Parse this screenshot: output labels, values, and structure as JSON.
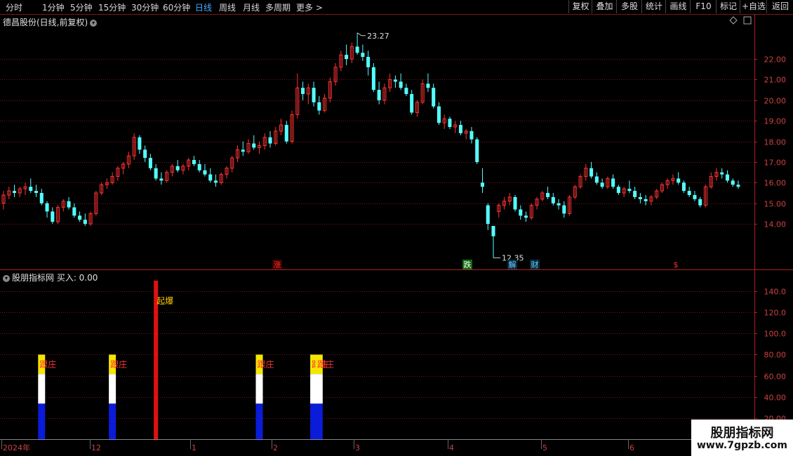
{
  "toolbar": {
    "periods": [
      "分时",
      "1分钟",
      "5分钟",
      "15分钟",
      "30分钟",
      "60分钟",
      "日线",
      "周线",
      "月线",
      "多周期",
      "更多 >"
    ],
    "active_period": "日线",
    "buttons": [
      "复权",
      "叠加",
      "多股",
      "统计",
      "画线",
      "F10",
      "标记",
      "+自选",
      "返回"
    ]
  },
  "stock": {
    "title": "德昌股份(日线,前复权)"
  },
  "indicator": {
    "title": "股朋指标网 买入: 0.00"
  },
  "price_labels": {
    "high": "23.27",
    "low": "12.35"
  },
  "markers": [
    {
      "text": "涨",
      "color": "#ff3030",
      "bg": "#3a0000"
    },
    {
      "text": "跌",
      "color": "#ffffff",
      "bg": "#0f6a0f"
    },
    {
      "text": "解",
      "color": "#66ccff",
      "bg": "#0a2a3a"
    },
    {
      "text": "财",
      "color": "#66ccff",
      "bg": "#0a2a3a"
    },
    {
      "text": "$",
      "color": "#ff3030",
      "bg": "#000000"
    }
  ],
  "signals": {
    "genzhuang": "跟庄",
    "qibao": "起爆"
  },
  "watermark": {
    "line1": "股朋指标网",
    "line2": "www.7gpzb.com"
  },
  "colors": {
    "up": "#ff3232",
    "down": "#54ffff",
    "grid": "#7a1414"
  },
  "chart_data": {
    "type": "candlestick",
    "price_axis": {
      "ticks": [
        "22.00",
        "21.00",
        "20.00",
        "19.00",
        "18.00",
        "17.00",
        "16.00",
        "15.00",
        "14.00"
      ],
      "range": [
        12.2,
        23.5
      ]
    },
    "indicator_axis": {
      "ticks": [
        "140.0",
        "120.0",
        "100.0",
        "80.00",
        "60.00",
        "40.00",
        "20.00"
      ],
      "range": [
        0,
        150
      ]
    },
    "date_labels": [
      "2024年",
      "12",
      "1",
      "2",
      "3",
      "4",
      "5",
      "6"
    ],
    "ohlc": [
      [
        15.0,
        15.6,
        14.7,
        15.4
      ],
      [
        15.4,
        15.8,
        15.2,
        15.6
      ],
      [
        15.6,
        15.9,
        15.3,
        15.5
      ],
      [
        15.5,
        15.8,
        15.3,
        15.7
      ],
      [
        15.7,
        16.0,
        15.4,
        15.8
      ],
      [
        15.8,
        16.2,
        15.5,
        15.6
      ],
      [
        15.6,
        15.9,
        15.3,
        15.5
      ],
      [
        15.5,
        15.7,
        14.9,
        15.0
      ],
      [
        15.0,
        15.1,
        14.3,
        14.6
      ],
      [
        14.6,
        14.8,
        14.0,
        14.1
      ],
      [
        14.1,
        14.9,
        14.0,
        14.8
      ],
      [
        14.8,
        15.2,
        14.6,
        15.1
      ],
      [
        15.1,
        15.3,
        14.7,
        14.8
      ],
      [
        14.8,
        15.0,
        14.3,
        14.4
      ],
      [
        14.4,
        14.6,
        14.1,
        14.2
      ],
      [
        14.2,
        14.5,
        13.9,
        14.0
      ],
      [
        14.0,
        14.6,
        13.9,
        14.5
      ],
      [
        14.5,
        15.6,
        14.4,
        15.5
      ],
      [
        15.5,
        16.0,
        15.4,
        15.9
      ],
      [
        15.9,
        16.2,
        15.7,
        16.0
      ],
      [
        16.0,
        16.5,
        15.9,
        16.3
      ],
      [
        16.3,
        16.8,
        16.1,
        16.7
      ],
      [
        16.7,
        17.0,
        16.4,
        16.9
      ],
      [
        16.9,
        17.5,
        16.7,
        17.3
      ],
      [
        17.3,
        18.4,
        17.1,
        18.2
      ],
      [
        18.2,
        18.3,
        17.4,
        17.6
      ],
      [
        17.6,
        17.8,
        17.0,
        17.2
      ],
      [
        17.2,
        17.4,
        16.6,
        16.7
      ],
      [
        16.7,
        16.9,
        16.1,
        16.2
      ],
      [
        16.2,
        16.5,
        15.9,
        16.1
      ],
      [
        16.1,
        16.6,
        16.0,
        16.5
      ],
      [
        16.5,
        16.9,
        16.3,
        16.8
      ],
      [
        16.8,
        17.1,
        16.5,
        16.6
      ],
      [
        16.6,
        16.9,
        16.4,
        16.8
      ],
      [
        16.8,
        17.2,
        16.6,
        17.1
      ],
      [
        17.1,
        17.3,
        16.8,
        16.9
      ],
      [
        16.9,
        17.1,
        16.5,
        16.6
      ],
      [
        16.6,
        16.9,
        16.3,
        16.4
      ],
      [
        16.4,
        16.7,
        16.0,
        16.1
      ],
      [
        16.1,
        16.4,
        15.8,
        16.0
      ],
      [
        16.0,
        16.5,
        15.9,
        16.4
      ],
      [
        16.4,
        16.8,
        16.2,
        16.7
      ],
      [
        16.7,
        17.3,
        16.5,
        17.2
      ],
      [
        17.2,
        17.8,
        17.0,
        17.6
      ],
      [
        17.6,
        18.0,
        17.3,
        17.5
      ],
      [
        17.5,
        18.1,
        17.4,
        17.9
      ],
      [
        17.9,
        18.3,
        17.6,
        17.7
      ],
      [
        17.7,
        18.0,
        17.4,
        17.8
      ],
      [
        17.8,
        18.4,
        17.6,
        18.2
      ],
      [
        18.2,
        18.5,
        17.7,
        17.9
      ],
      [
        17.9,
        18.7,
        17.8,
        18.5
      ],
      [
        18.5,
        19.1,
        18.3,
        18.8
      ],
      [
        18.8,
        19.0,
        17.9,
        18.0
      ],
      [
        18.0,
        19.5,
        17.9,
        19.3
      ],
      [
        19.3,
        21.3,
        19.1,
        20.6
      ],
      [
        20.6,
        20.9,
        20.0,
        20.3
      ],
      [
        20.3,
        20.8,
        19.8,
        20.6
      ],
      [
        20.6,
        20.9,
        19.7,
        19.9
      ],
      [
        19.9,
        20.2,
        19.3,
        19.5
      ],
      [
        19.5,
        20.3,
        19.4,
        20.1
      ],
      [
        20.1,
        21.1,
        19.9,
        20.9
      ],
      [
        20.9,
        21.8,
        20.7,
        21.6
      ],
      [
        21.6,
        22.4,
        21.4,
        22.2
      ],
      [
        22.2,
        22.7,
        21.7,
        22.0
      ],
      [
        22.0,
        22.8,
        21.8,
        22.6
      ],
      [
        22.6,
        23.27,
        22.2,
        22.3
      ],
      [
        22.3,
        22.7,
        21.9,
        22.1
      ],
      [
        22.1,
        22.4,
        21.2,
        21.6
      ],
      [
        21.6,
        21.8,
        20.4,
        20.5
      ],
      [
        20.5,
        20.9,
        19.8,
        20.0
      ],
      [
        20.0,
        20.8,
        19.8,
        20.6
      ],
      [
        20.6,
        21.3,
        20.4,
        21.0
      ],
      [
        21.0,
        21.2,
        20.6,
        20.9
      ],
      [
        20.9,
        21.3,
        20.5,
        20.6
      ],
      [
        20.6,
        20.8,
        20.2,
        20.3
      ],
      [
        20.3,
        20.5,
        19.3,
        19.4
      ],
      [
        19.4,
        20.0,
        19.2,
        19.9
      ],
      [
        19.9,
        21.0,
        19.8,
        20.8
      ],
      [
        20.8,
        21.3,
        20.4,
        20.6
      ],
      [
        20.6,
        20.8,
        19.6,
        19.7
      ],
      [
        19.7,
        19.9,
        18.8,
        18.9
      ],
      [
        18.9,
        19.3,
        18.6,
        19.1
      ],
      [
        19.1,
        19.2,
        18.6,
        18.7
      ],
      [
        18.7,
        19.0,
        18.4,
        18.8
      ],
      [
        18.8,
        19.0,
        18.3,
        18.4
      ],
      [
        18.4,
        18.6,
        18.1,
        18.5
      ],
      [
        18.5,
        18.7,
        17.9,
        18.1
      ],
      [
        18.1,
        18.2,
        16.9,
        17.0
      ],
      [
        16.0,
        16.7,
        15.5,
        15.8
      ],
      [
        14.9,
        15.0,
        13.7,
        14.0
      ],
      [
        13.9,
        13.9,
        12.35,
        13.4
      ],
      [
        14.6,
        15.0,
        14.3,
        14.9
      ],
      [
        14.9,
        15.3,
        14.7,
        15.1
      ],
      [
        15.1,
        15.5,
        14.9,
        15.3
      ],
      [
        15.3,
        15.4,
        14.6,
        14.7
      ],
      [
        14.7,
        14.9,
        14.2,
        14.4
      ],
      [
        14.4,
        14.6,
        14.1,
        14.3
      ],
      [
        14.3,
        15.0,
        14.2,
        14.9
      ],
      [
        14.9,
        15.3,
        14.7,
        15.2
      ],
      [
        15.2,
        15.6,
        15.1,
        15.5
      ],
      [
        15.5,
        15.8,
        15.2,
        15.3
      ],
      [
        15.3,
        15.5,
        14.9,
        15.0
      ],
      [
        15.0,
        15.2,
        14.7,
        14.9
      ],
      [
        14.9,
        15.1,
        14.3,
        14.5
      ],
      [
        14.5,
        15.4,
        14.4,
        15.3
      ],
      [
        15.3,
        15.9,
        15.2,
        15.8
      ],
      [
        15.8,
        16.4,
        15.7,
        16.3
      ],
      [
        16.3,
        16.9,
        16.1,
        16.7
      ],
      [
        16.7,
        17.0,
        16.2,
        16.3
      ],
      [
        16.3,
        16.5,
        15.9,
        16.0
      ],
      [
        16.0,
        16.2,
        15.7,
        15.8
      ],
      [
        15.8,
        16.3,
        15.7,
        16.2
      ],
      [
        16.2,
        16.4,
        15.7,
        15.8
      ],
      [
        15.8,
        15.9,
        15.4,
        15.5
      ],
      [
        15.5,
        15.8,
        15.3,
        15.7
      ],
      [
        15.7,
        16.1,
        15.5,
        15.6
      ],
      [
        15.6,
        15.8,
        15.2,
        15.3
      ],
      [
        15.3,
        15.5,
        15.0,
        15.2
      ],
      [
        15.2,
        15.4,
        14.9,
        15.1
      ],
      [
        15.1,
        15.4,
        14.9,
        15.3
      ],
      [
        15.3,
        15.7,
        15.2,
        15.6
      ],
      [
        15.6,
        16.0,
        15.5,
        15.9
      ],
      [
        15.9,
        16.2,
        15.7,
        16.1
      ],
      [
        16.1,
        16.4,
        15.9,
        16.2
      ],
      [
        16.2,
        16.5,
        15.9,
        16.0
      ],
      [
        16.0,
        16.1,
        15.5,
        15.6
      ],
      [
        15.6,
        15.8,
        15.3,
        15.4
      ],
      [
        15.4,
        15.6,
        15.1,
        15.2
      ],
      [
        15.2,
        15.3,
        14.8,
        14.9
      ],
      [
        14.9,
        15.9,
        14.8,
        15.8
      ],
      [
        15.8,
        16.5,
        15.7,
        16.3
      ],
      [
        16.3,
        16.7,
        16.1,
        16.5
      ],
      [
        16.5,
        16.7,
        16.2,
        16.4
      ],
      [
        16.4,
        16.6,
        16.0,
        16.1
      ],
      [
        16.1,
        16.2,
        15.8,
        15.9
      ],
      [
        15.9,
        16.1,
        15.7,
        15.8
      ]
    ],
    "signal_bars": [
      {
        "index": 7,
        "type": "跟庄",
        "value": 80
      },
      {
        "index": 20,
        "type": "跟庄",
        "value": 80
      },
      {
        "index": 28,
        "type": "起爆",
        "value": 150
      },
      {
        "index": 47,
        "type": "跟庄",
        "value": 80
      },
      {
        "index": 57,
        "type": "跟庄",
        "value": 80
      },
      {
        "index": 58,
        "type": "跟庄",
        "value": 80
      }
    ]
  }
}
